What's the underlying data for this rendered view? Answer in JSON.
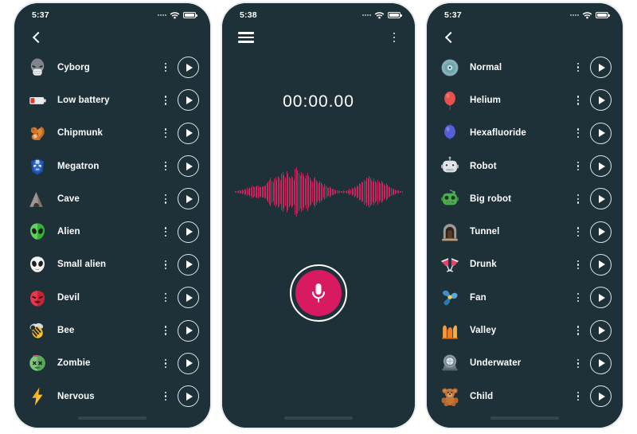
{
  "app": {
    "background_color": "#ffffff",
    "screen_bg": "#1e3139",
    "accent_color": "#d81b60",
    "wave_color": "#c8255c",
    "text_color": "#ffffff"
  },
  "phones": [
    {
      "id": "phone-effects-voices",
      "status": {
        "time": "5:37",
        "signal_icon": "signal-dots-icon",
        "wifi_icon": "wifi-icon",
        "battery_icon": "battery-full-icon"
      },
      "nav": {
        "back_icon": "back-chevron-icon"
      },
      "items": [
        {
          "label": "Cyborg",
          "icon": "cyborg-emoji",
          "menu_icon": "kebab-menu-icon",
          "play_icon": "play-icon"
        },
        {
          "label": "Low battery",
          "icon": "low-battery-emoji",
          "menu_icon": "kebab-menu-icon",
          "play_icon": "play-icon"
        },
        {
          "label": "Chipmunk",
          "icon": "squirrel-emoji",
          "menu_icon": "kebab-menu-icon",
          "play_icon": "play-icon"
        },
        {
          "label": "Megatron",
          "icon": "megatron-emoji",
          "menu_icon": "kebab-menu-icon",
          "play_icon": "play-icon"
        },
        {
          "label": "Cave",
          "icon": "cave-emoji",
          "menu_icon": "kebab-menu-icon",
          "play_icon": "play-icon"
        },
        {
          "label": "Alien",
          "icon": "alien-emoji",
          "menu_icon": "kebab-menu-icon",
          "play_icon": "play-icon"
        },
        {
          "label": "Small alien",
          "icon": "small-alien-emoji",
          "menu_icon": "kebab-menu-icon",
          "play_icon": "play-icon"
        },
        {
          "label": "Devil",
          "icon": "devil-emoji",
          "menu_icon": "kebab-menu-icon",
          "play_icon": "play-icon"
        },
        {
          "label": "Bee",
          "icon": "bee-emoji",
          "menu_icon": "kebab-menu-icon",
          "play_icon": "play-icon"
        },
        {
          "label": "Zombie",
          "icon": "zombie-emoji",
          "menu_icon": "kebab-menu-icon",
          "play_icon": "play-icon"
        },
        {
          "label": "Nervous",
          "icon": "lightning-emoji",
          "menu_icon": "kebab-menu-icon",
          "play_icon": "play-icon"
        }
      ]
    },
    {
      "id": "phone-recorder",
      "status": {
        "time": "5:38",
        "signal_icon": "signal-dots-icon",
        "wifi_icon": "wifi-icon",
        "battery_icon": "battery-full-icon"
      },
      "nav": {
        "menu_icon": "hamburger-menu-icon",
        "overflow_icon": "kebab-menu-icon"
      },
      "recorder": {
        "timer": "00:00.00",
        "record_label": "microphone-icon",
        "waveform": [
          2,
          2,
          2,
          3,
          4,
          3,
          5,
          4,
          6,
          5,
          8,
          7,
          10,
          9,
          13,
          11,
          10,
          12,
          14,
          13,
          11,
          10,
          12,
          11,
          14,
          13,
          18,
          22,
          26,
          30,
          24,
          20,
          28,
          32,
          26,
          34,
          30,
          25,
          38,
          42,
          36,
          30,
          44,
          38,
          32,
          28,
          34,
          30,
          26,
          48,
          52,
          46,
          40,
          36,
          42,
          38,
          33,
          28,
          36,
          40,
          34,
          30,
          26,
          22,
          28,
          32,
          26,
          22,
          18,
          24,
          20,
          16,
          12,
          16,
          14,
          10,
          8,
          12,
          9,
          7,
          6,
          5,
          4,
          3,
          3,
          2,
          2,
          2,
          3,
          2,
          2,
          3,
          4,
          6,
          5,
          8,
          7,
          11,
          9,
          14,
          12,
          18,
          16,
          22,
          20,
          26,
          24,
          30,
          28,
          34,
          30,
          26,
          22,
          28,
          24,
          20,
          26,
          22,
          18,
          24,
          20,
          16,
          13,
          18,
          15,
          12,
          10,
          8,
          7,
          6,
          5,
          4,
          3,
          3,
          2,
          2,
          2
        ]
      }
    },
    {
      "id": "phone-effects-ambient",
      "status": {
        "time": "5:37",
        "signal_icon": "signal-dots-icon",
        "wifi_icon": "wifi-icon",
        "battery_icon": "battery-full-icon"
      },
      "nav": {
        "back_icon": "back-chevron-icon"
      },
      "items": [
        {
          "label": "Normal",
          "icon": "cd-disc-emoji",
          "menu_icon": "kebab-menu-icon",
          "play_icon": "play-icon"
        },
        {
          "label": "Helium",
          "icon": "red-balloon-emoji",
          "menu_icon": "kebab-menu-icon",
          "play_icon": "play-icon"
        },
        {
          "label": "Hexafluoride",
          "icon": "blue-balloon-emoji",
          "menu_icon": "kebab-menu-icon",
          "play_icon": "play-icon"
        },
        {
          "label": "Robot",
          "icon": "robot-emoji",
          "menu_icon": "kebab-menu-icon",
          "play_icon": "play-icon"
        },
        {
          "label": "Big robot",
          "icon": "green-robot-emoji",
          "menu_icon": "kebab-menu-icon",
          "play_icon": "play-icon"
        },
        {
          "label": "Tunnel",
          "icon": "tunnel-emoji",
          "menu_icon": "kebab-menu-icon",
          "play_icon": "play-icon"
        },
        {
          "label": "Drunk",
          "icon": "clinking-glasses-emoji",
          "menu_icon": "kebab-menu-icon",
          "play_icon": "play-icon"
        },
        {
          "label": "Fan",
          "icon": "fan-emoji",
          "menu_icon": "kebab-menu-icon",
          "play_icon": "play-icon"
        },
        {
          "label": "Valley",
          "icon": "valley-emoji",
          "menu_icon": "kebab-menu-icon",
          "play_icon": "play-icon"
        },
        {
          "label": "Underwater",
          "icon": "diving-helmet-emoji",
          "menu_icon": "kebab-menu-icon",
          "play_icon": "play-icon"
        },
        {
          "label": "Child",
          "icon": "teddy-bear-emoji",
          "menu_icon": "kebab-menu-icon",
          "play_icon": "play-icon"
        }
      ]
    }
  ]
}
